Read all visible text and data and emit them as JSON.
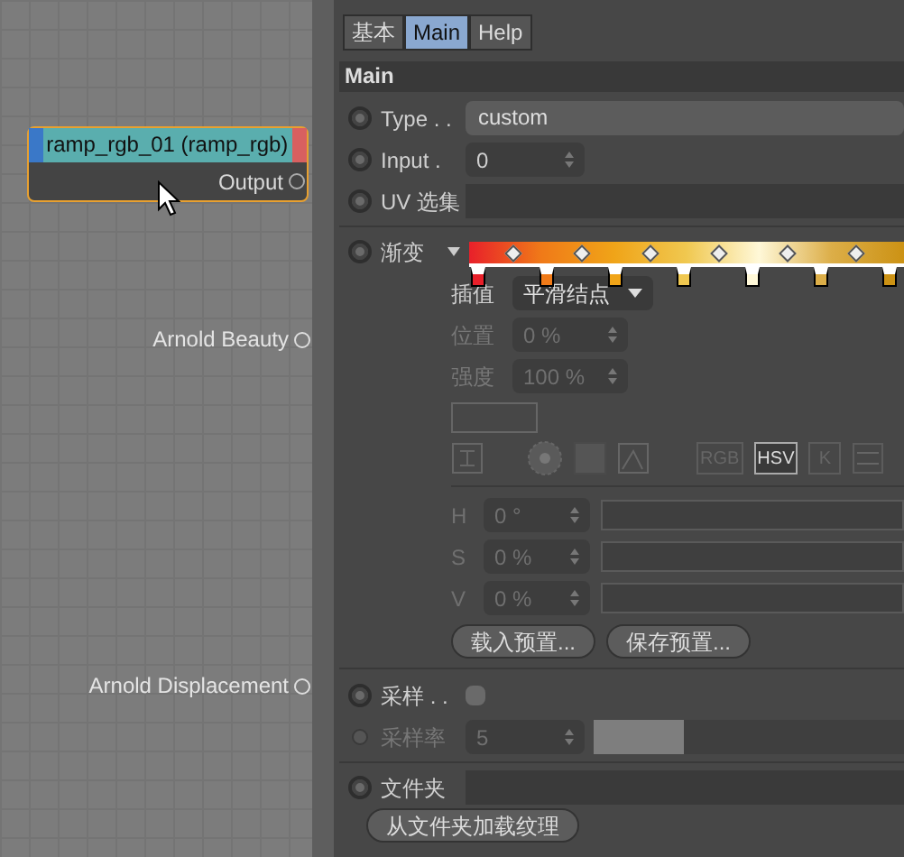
{
  "canvas": {
    "node": {
      "title": "ramp_rgb_01 (ramp_rgb)",
      "output": "Output"
    },
    "ports": [
      {
        "label": "Arnold Beauty"
      },
      {
        "label": "Arnold Displacement"
      }
    ]
  },
  "tabs": [
    {
      "label": "基本",
      "selected": false
    },
    {
      "label": "Main",
      "selected": true
    },
    {
      "label": "Help",
      "selected": false
    }
  ],
  "section": "Main",
  "fields": [
    {
      "label": "Type . .",
      "kind": "text",
      "value": "custom",
      "keyed": false
    },
    {
      "label": "Input .",
      "kind": "spinner",
      "value": "0",
      "keyed": false
    },
    {
      "label": "UV 选集",
      "kind": "empty",
      "keyed": false
    }
  ],
  "gradient": {
    "label": "渐变",
    "keyed": false,
    "stops": [
      {
        "color": "#e8202a"
      },
      {
        "color": "#f07a18"
      },
      {
        "color": "#f0a418"
      },
      {
        "color": "#f0c850"
      },
      {
        "color": "#fff8d8"
      },
      {
        "color": "#dcae48"
      },
      {
        "color": "#cc9214"
      }
    ],
    "interpolation": {
      "label": "插值",
      "value": "平滑结点"
    },
    "position": {
      "label": "位置",
      "value": "0 %"
    },
    "strength": {
      "label": "强度",
      "value": "100 %"
    },
    "modes": [
      {
        "label": "RGB",
        "selected": false
      },
      {
        "label": "HSV",
        "selected": true
      },
      {
        "label": "K",
        "selected": false
      }
    ],
    "hsv": [
      {
        "label": "H",
        "value": "0 °",
        "level": 0
      },
      {
        "label": "S",
        "value": "0 %",
        "level": 0
      },
      {
        "label": "V",
        "value": "0 %",
        "level": 0
      }
    ],
    "buttons": [
      "载入预置...",
      "保存预置..."
    ]
  },
  "sample": {
    "label": "采样 . .",
    "checked": false,
    "keyed": false
  },
  "sample_rate": {
    "label": "采样率",
    "value": "5",
    "disabled": true,
    "level": 0.29
  },
  "folder": {
    "label": "文件夹",
    "button": "从文件夹加载纹理",
    "keyed": false
  }
}
